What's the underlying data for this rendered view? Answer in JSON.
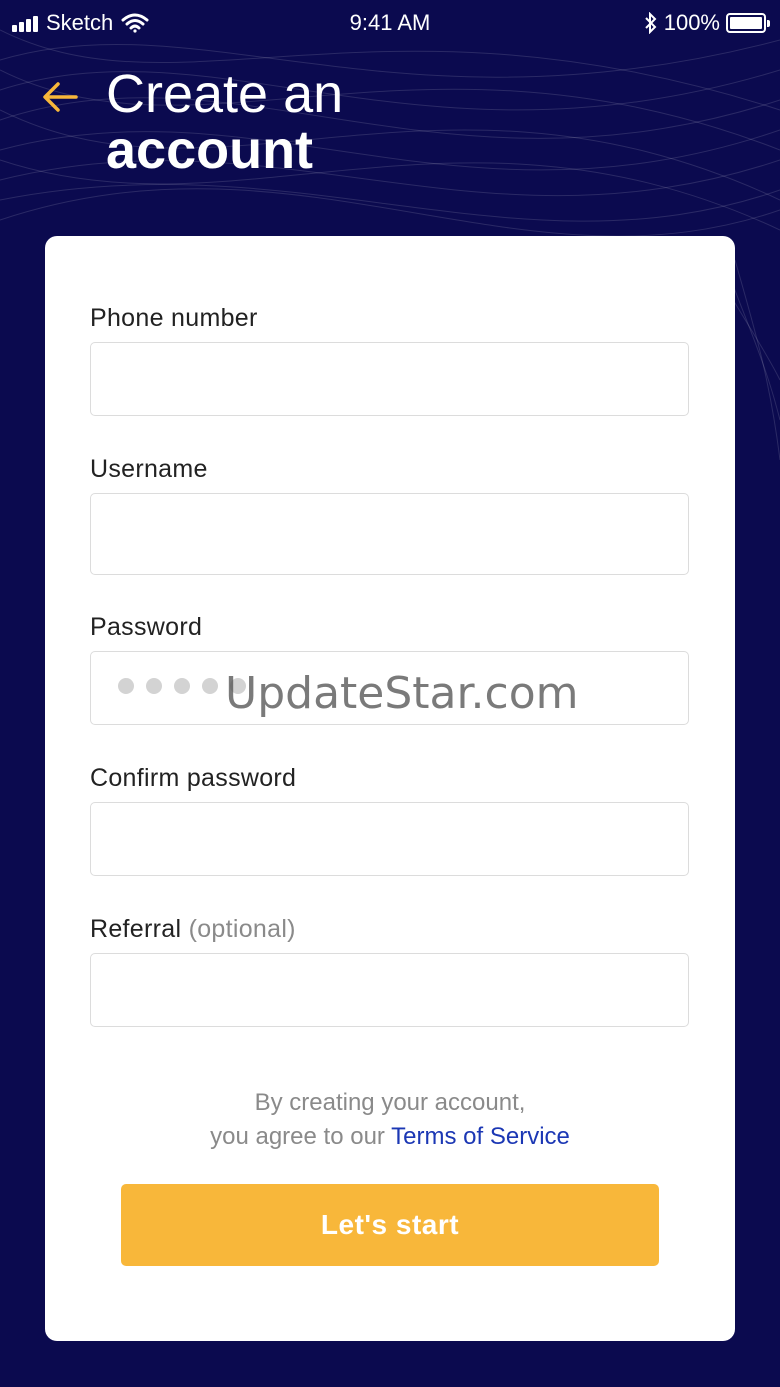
{
  "colors": {
    "background": "#0b0a4f",
    "accent": "#f8b73a",
    "link": "#1b37b4",
    "card": "#ffffff"
  },
  "status_bar": {
    "carrier": "Sketch",
    "time": "9:41 AM",
    "battery": "100%",
    "icons": [
      "signal-icon",
      "wifi-icon",
      "bluetooth-icon",
      "battery-icon"
    ]
  },
  "header": {
    "back_icon": "arrow-left-icon",
    "title_line1": "Create an",
    "title_line2": "account"
  },
  "form": {
    "phone": {
      "label": "Phone number",
      "value": ""
    },
    "username": {
      "label": "Username",
      "value": ""
    },
    "password": {
      "label": "Password",
      "masked_chars": 5
    },
    "confirm_password": {
      "label": "Confirm password",
      "value": ""
    },
    "referral": {
      "label": "Referral",
      "optional_hint": "(optional)",
      "value": ""
    }
  },
  "terms": {
    "line1": "By creating your account,",
    "line2_prefix": "you agree to our",
    "link_text": "Terms of Service"
  },
  "submit_label": "Let's start",
  "watermark": "UpdateStar.com"
}
